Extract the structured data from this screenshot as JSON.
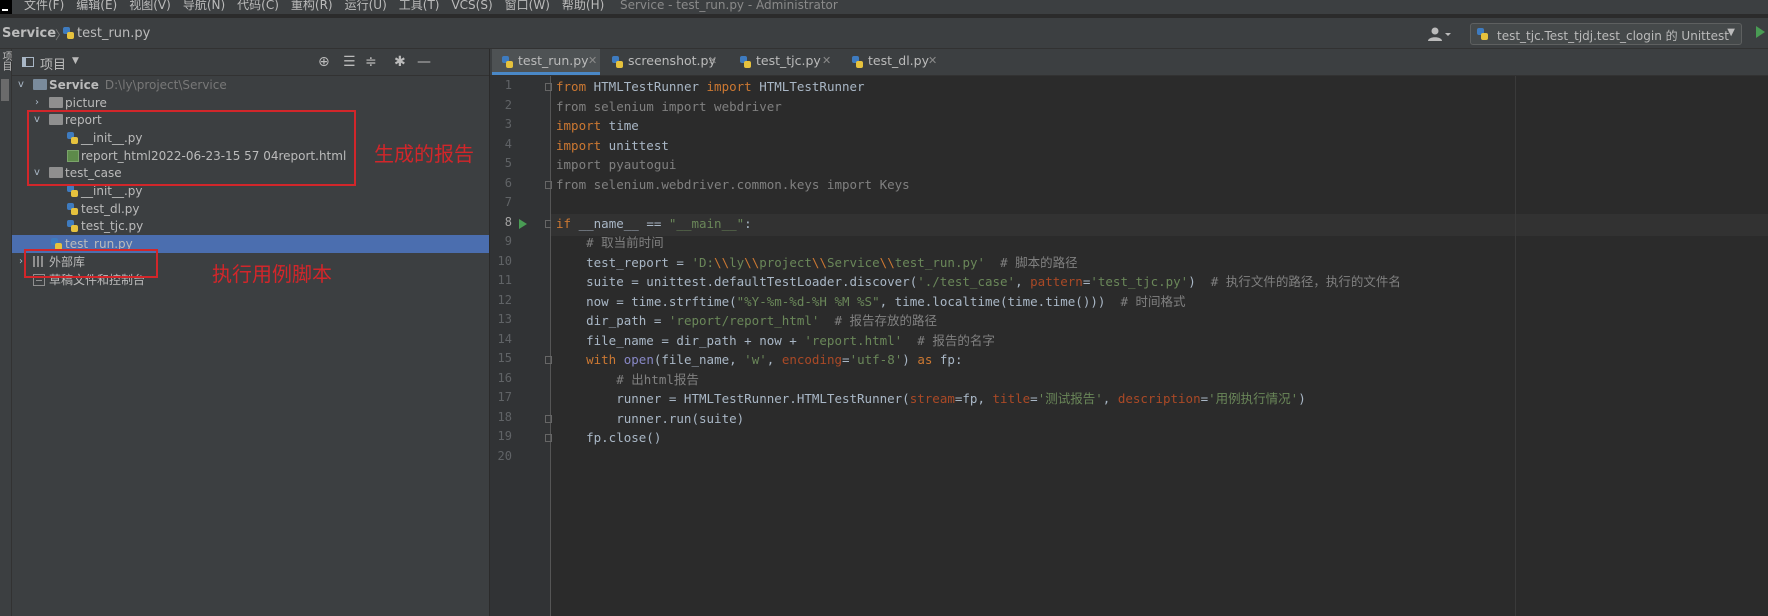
{
  "menu": {
    "items": [
      "文件(F)",
      "编辑(E)",
      "视图(V)",
      "导航(N)",
      "代码(C)",
      "重构(R)",
      "运行(U)",
      "工具(T)",
      "VCS(S)",
      "窗口(W)",
      "帮助(H)"
    ],
    "window_title": "Service - test_run.py - Administrator"
  },
  "navbar": {
    "root": "Service",
    "separator": "〉",
    "file": "test_run.py",
    "run_config": "test_tjc.Test_tjdj.test_clogin 的 Unittest"
  },
  "left_strip": {
    "label": "项目"
  },
  "project_panel": {
    "title": "项目",
    "tree": [
      {
        "label": "Service",
        "path": "D:\\ly\\project\\Service",
        "icon": "folder",
        "expanded": true
      },
      {
        "label": "picture",
        "icon": "folder",
        "expanded": false
      },
      {
        "label": "report",
        "icon": "folder",
        "expanded": true
      },
      {
        "label": "__init__.py",
        "icon": "python-file"
      },
      {
        "label": "report_html2022-06-23-15 57 04report.html",
        "icon": "html-file"
      },
      {
        "label": "test_case",
        "icon": "folder",
        "expanded": true
      },
      {
        "label": "__init__.py",
        "icon": "python-file"
      },
      {
        "label": "test_dl.py",
        "icon": "python-file"
      },
      {
        "label": "test_tjc.py",
        "icon": "python-file"
      },
      {
        "label": "test_run.py",
        "icon": "python-file",
        "selected": true
      },
      {
        "label": "外部库",
        "icon": "library",
        "expanded": false
      },
      {
        "label": "草稿文件和控制台",
        "icon": "scratch"
      }
    ]
  },
  "annotations": {
    "report_note": "生成的报告",
    "script_note": "执行用例脚本",
    "color": "#d2262a"
  },
  "editor": {
    "tabs": [
      {
        "label": "test_run.py",
        "active": true
      },
      {
        "label": "screenshot.py",
        "active": false
      },
      {
        "label": "test_tjc.py",
        "active": false
      },
      {
        "label": "test_dl.py",
        "active": false
      }
    ],
    "current_line": 8,
    "lines": [
      [
        [
          "kw",
          "from"
        ],
        [
          "t",
          " HTMLTestRunner "
        ],
        [
          "kw",
          "import"
        ],
        [
          "t",
          " HTMLTestRunner"
        ]
      ],
      [
        [
          "dim",
          "from selenium import webdriver"
        ]
      ],
      [
        [
          "kw",
          "import"
        ],
        [
          "t",
          " time"
        ]
      ],
      [
        [
          "kw",
          "import"
        ],
        [
          "t",
          " unittest"
        ]
      ],
      [
        [
          "dim",
          "import pyautogui"
        ]
      ],
      [
        [
          "dim",
          "from selenium.webdriver.common.keys import Keys"
        ]
      ],
      [],
      [
        [
          "kw",
          "if"
        ],
        [
          "t",
          " __name__ == "
        ],
        [
          "str",
          "\"__main__\""
        ],
        [
          "t",
          ":"
        ]
      ],
      [
        [
          "t",
          "    "
        ],
        [
          "cm",
          "# 取当前时间"
        ]
      ],
      [
        [
          "t",
          "    test_report = "
        ],
        [
          "str",
          "'D:"
        ],
        [
          "esc",
          "\\\\"
        ],
        [
          "str",
          "ly"
        ],
        [
          "esc",
          "\\\\"
        ],
        [
          "str",
          "project"
        ],
        [
          "esc",
          "\\\\"
        ],
        [
          "str",
          "Service"
        ],
        [
          "esc",
          "\\\\"
        ],
        [
          "str",
          "test_run.py'"
        ],
        [
          "t",
          "  "
        ],
        [
          "cm",
          "# 脚本的路径"
        ]
      ],
      [
        [
          "t",
          "    suite = unittest.defaultTestLoader.discover("
        ],
        [
          "str",
          "'./test_case'"
        ],
        [
          "t",
          ", "
        ],
        [
          "prm",
          "pattern"
        ],
        [
          "t",
          "="
        ],
        [
          "str",
          "'test_tjc.py'"
        ],
        [
          "t",
          ")  "
        ],
        [
          "cm",
          "# 执行文件的路径，执行的文件名"
        ]
      ],
      [
        [
          "t",
          "    now = time.strftime("
        ],
        [
          "str",
          "\"%Y-%m-%d-%H %M %S\""
        ],
        [
          "t",
          ", time.localtime(time.time()))  "
        ],
        [
          "cm",
          "# 时间格式"
        ]
      ],
      [
        [
          "t",
          "    dir_path = "
        ],
        [
          "str",
          "'report/report_html'"
        ],
        [
          "t",
          "  "
        ],
        [
          "cm",
          "# 报告存放的路径"
        ]
      ],
      [
        [
          "t",
          "    file_name = dir_path + now + "
        ],
        [
          "str",
          "'report.html'"
        ],
        [
          "t",
          "  "
        ],
        [
          "cm",
          "# 报告的名字"
        ]
      ],
      [
        [
          "t",
          "    "
        ],
        [
          "kw",
          "with"
        ],
        [
          "t",
          " "
        ],
        [
          "bi",
          "open"
        ],
        [
          "t",
          "(file_name, "
        ],
        [
          "str",
          "'w'"
        ],
        [
          "t",
          ", "
        ],
        [
          "prm",
          "encoding"
        ],
        [
          "t",
          "="
        ],
        [
          "str",
          "'utf-8'"
        ],
        [
          "t",
          ") "
        ],
        [
          "kw",
          "as"
        ],
        [
          "t",
          " fp:"
        ]
      ],
      [
        [
          "t",
          "        "
        ],
        [
          "cm",
          "# 出html报告"
        ]
      ],
      [
        [
          "t",
          "        runner = HTMLTestRunner.HTMLTestRunner("
        ],
        [
          "prm",
          "stream"
        ],
        [
          "t",
          "=fp, "
        ],
        [
          "prm",
          "title"
        ],
        [
          "t",
          "="
        ],
        [
          "str",
          "'测试报告'"
        ],
        [
          "t",
          ", "
        ],
        [
          "prm",
          "description"
        ],
        [
          "t",
          "="
        ],
        [
          "str",
          "'用例执行情况'"
        ],
        [
          "t",
          ")"
        ]
      ],
      [
        [
          "t",
          "        runner.run(suite)"
        ]
      ],
      [
        [
          "t",
          "    fp.close()"
        ]
      ],
      []
    ],
    "line_numbers": [
      "1",
      "2",
      "3",
      "4",
      "5",
      "6",
      "7",
      "8",
      "9",
      "10",
      "11",
      "12",
      "13",
      "14",
      "15",
      "16",
      "17",
      "18",
      "19",
      "20"
    ]
  }
}
